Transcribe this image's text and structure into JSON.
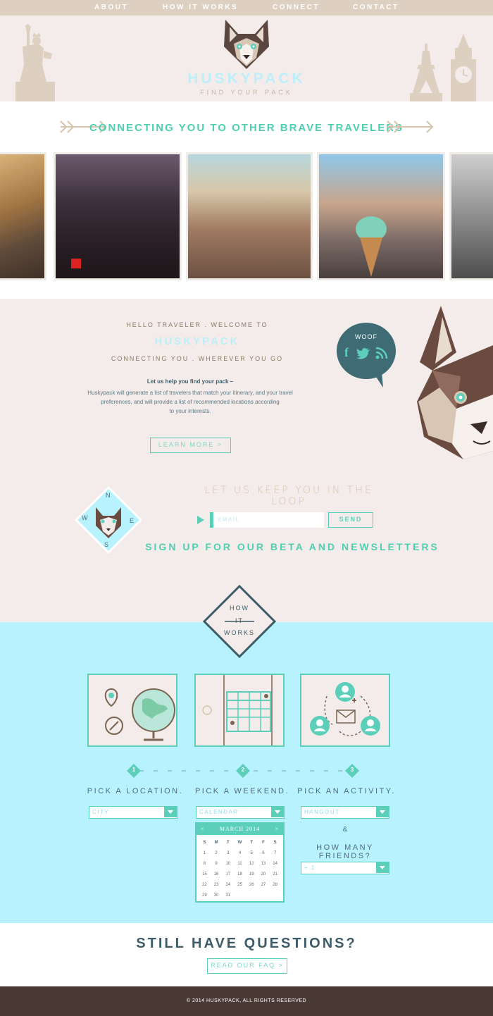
{
  "nav": {
    "items": [
      {
        "label": "ABOUT"
      },
      {
        "label": "HOW IT WORKS"
      },
      {
        "label": "CONNECT"
      },
      {
        "label": "CONTACT"
      }
    ]
  },
  "header": {
    "logo_text": "HUSKYPACK",
    "tagline": "FIND YOUR PACK"
  },
  "connecting": {
    "title": "CONNECTING YOU TO OTHER BRAVE TRAVELERS",
    "photos": [
      {
        "icon": "street-photo"
      },
      {
        "icon": "party-photo"
      },
      {
        "icon": "group-photo"
      },
      {
        "icon": "ice-cream-photo"
      },
      {
        "icon": "beach-photo"
      }
    ]
  },
  "welcome": {
    "hello": "HELLO TRAVELER . WELCOME TO",
    "name": "HUSKYPACK",
    "sub": "CONNECTING YOU . WHEREVER YOU GO",
    "bold": "Let us help you find your pack –",
    "body_1": "Huskypack will generate a list of travelers that match your itinerary, and your travel",
    "body_2": "preferences, and will provide a list of recommended locations according",
    "body_3": "to your interests.",
    "learn_more": "LEARN MORE >",
    "bubble_text": "WOOF"
  },
  "newsletter": {
    "loop": "LET US KEEP YOU IN THE LOOP",
    "email_placeholder": "EMAIL",
    "send": "SEND",
    "signup": "SIGN UP FOR OUR BETA AND NEWSLETTERS",
    "compass": {
      "n": "N",
      "e": "E",
      "s": "S",
      "w": "W"
    }
  },
  "how_it_works": {
    "badge": [
      "HOW",
      "IT",
      "WORKS"
    ],
    "steps": [
      {
        "num": "1",
        "label": "PICK A LOCATION.",
        "select": "CITY"
      },
      {
        "num": "2",
        "label": "PICK A WEEKEND.",
        "select": "CALENDAR"
      },
      {
        "num": "3",
        "label": "PICK AN ACTIVITY.",
        "select": "HANGOUT"
      }
    ],
    "amp": "&",
    "friends_label": "HOW MANY FRIENDS?",
    "friends_select": "+ 1",
    "calendar": {
      "month": "MARCH 2014",
      "prev": "<",
      "next": ">",
      "dow": [
        "S",
        "M",
        "T",
        "W",
        "T",
        "F",
        "S"
      ],
      "days": [
        "1",
        "2",
        "3",
        "4",
        "5",
        "6",
        "7",
        "8",
        "9",
        "10",
        "11",
        "12",
        "13",
        "14",
        "15",
        "16",
        "17",
        "18",
        "19",
        "20",
        "21",
        "22",
        "23",
        "24",
        "25",
        "26",
        "27",
        "28",
        "29",
        "30",
        "31"
      ]
    }
  },
  "questions": {
    "title": "STILL HAVE QUESTIONS?",
    "faq": "READ OUR FAQ >"
  },
  "footer": {
    "text": "© 2014 HUSKYPACK, ALL RIGHTS RESERVED"
  },
  "colors": {
    "teal": "#5ccfbb",
    "light_blue": "#b9f2ff",
    "cream": "#f3ecea",
    "nav_tan": "#ddd0c0",
    "brown": "#4a3a35"
  }
}
